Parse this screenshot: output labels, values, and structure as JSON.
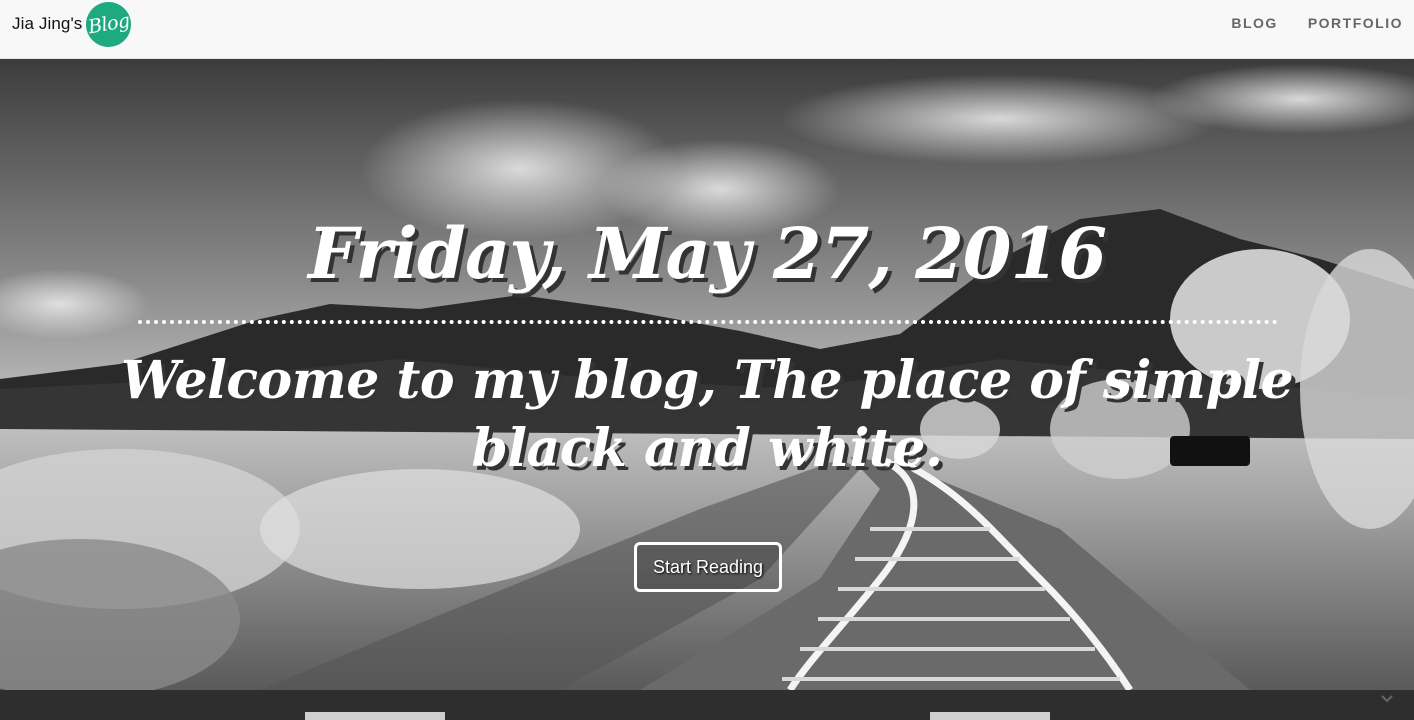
{
  "navbar": {
    "brand_text": "Jia Jing's",
    "brand_badge": "Blog",
    "links": [
      {
        "label": "BLOG"
      },
      {
        "label": "PORTFOLIO"
      }
    ]
  },
  "hero": {
    "date": "Friday, May 27, 2016",
    "welcome": "Welcome to my blog, The place of simple black and white.",
    "button_label": "Start Reading"
  },
  "colors": {
    "navbar_bg": "#f8f8f8",
    "brand_badge": "#1fa97e",
    "nav_link": "#666666",
    "hero_text": "#ffffff",
    "bottom_strip": "#2e2e2e"
  }
}
